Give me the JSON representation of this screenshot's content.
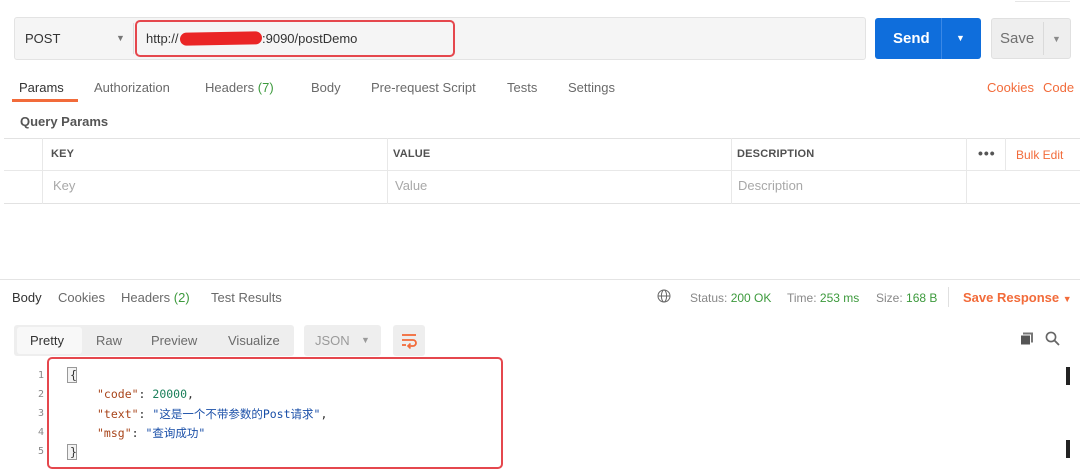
{
  "request": {
    "method": "POST",
    "url_prefix": "http://",
    "url_suffix": ":9090/postDemo",
    "send_label": "Send",
    "save_label": "Save"
  },
  "request_tabs": {
    "params": "Params",
    "authorization": "Authorization",
    "headers": "Headers",
    "headers_count": "(7)",
    "body": "Body",
    "prerequest": "Pre-request Script",
    "tests": "Tests",
    "settings": "Settings",
    "cookies": "Cookies",
    "code": "Code"
  },
  "query_params": {
    "title": "Query Params",
    "columns": [
      "KEY",
      "VALUE",
      "DESCRIPTION"
    ],
    "placeholders": [
      "Key",
      "Value",
      "Description"
    ],
    "more": "•••",
    "bulk_edit": "Bulk Edit"
  },
  "response": {
    "tabs": {
      "body": "Body",
      "cookies": "Cookies",
      "headers": "Headers",
      "headers_count": "(2)",
      "test_results": "Test Results"
    },
    "status_label": "Status:",
    "status_value": "200 OK",
    "time_label": "Time:",
    "time_value": "253 ms",
    "size_label": "Size:",
    "size_value": "168 B",
    "save_response": "Save Response",
    "views": [
      "Pretty",
      "Raw",
      "Preview",
      "Visualize"
    ],
    "format": "JSON"
  },
  "code": {
    "line_numbers": [
      "1",
      "2",
      "3",
      "4",
      "5"
    ],
    "open_brace": "{",
    "close_brace": "}",
    "code_key": "\"code\"",
    "code_value": "20000",
    "text_key": "\"text\"",
    "text_value": "\"这是一个不带参数的Post请求\"",
    "msg_key": "\"msg\"",
    "msg_value": "\"查询成功\""
  },
  "colors": {
    "accent_orange": "#f26b3a",
    "send_blue": "#0f6edc",
    "status_green": "#3d9a3d",
    "highlight_red": "#e5474d"
  }
}
